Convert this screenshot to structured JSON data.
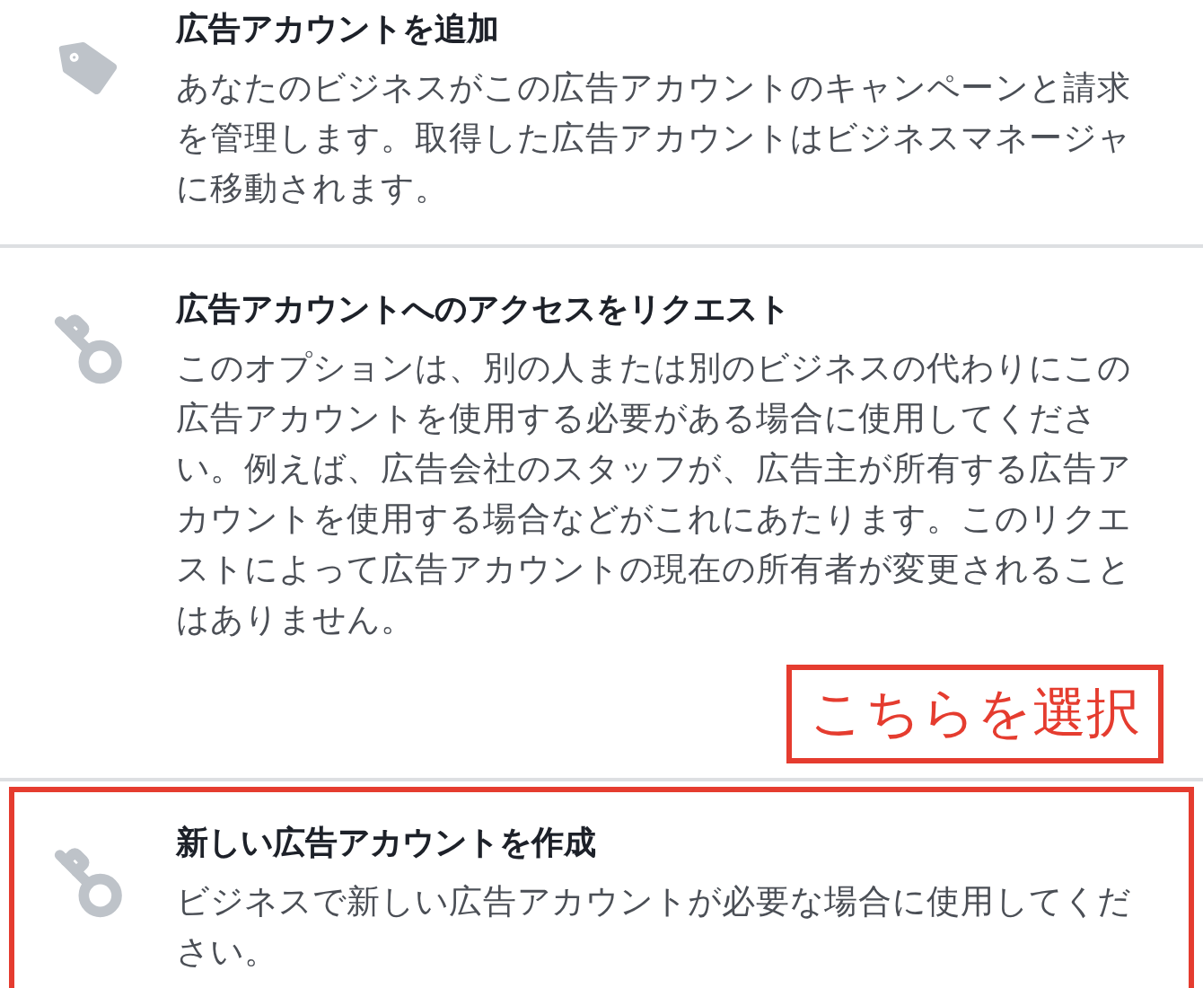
{
  "options": [
    {
      "kind": "tag",
      "title": "広告アカウントを追加",
      "description": "あなたのビジネスがこの広告アカウントのキャンペーンと請求を管理します。取得した広告アカウントはビジネスマネージャに移動されます。",
      "highlighted": false
    },
    {
      "kind": "key",
      "title": "広告アカウントへのアクセスをリクエスト",
      "description": "このオプションは、別の人または別のビジネスの代わりにこの広告アカウントを使用する必要がある場合に使用してください。例えば、広告会社のスタッフが、広告主が所有する広告アカウントを使用する場合などがこれにあたります。このリクエストによって広告アカウントの現在の所有者が変更されることはありません。",
      "highlighted": false,
      "callout": "こちらを選択"
    },
    {
      "kind": "key",
      "title": "新しい広告アカウントを作成",
      "description": "ビジネスで新しい広告アカウントが必要な場合に使用してください。",
      "highlighted": true
    }
  ]
}
